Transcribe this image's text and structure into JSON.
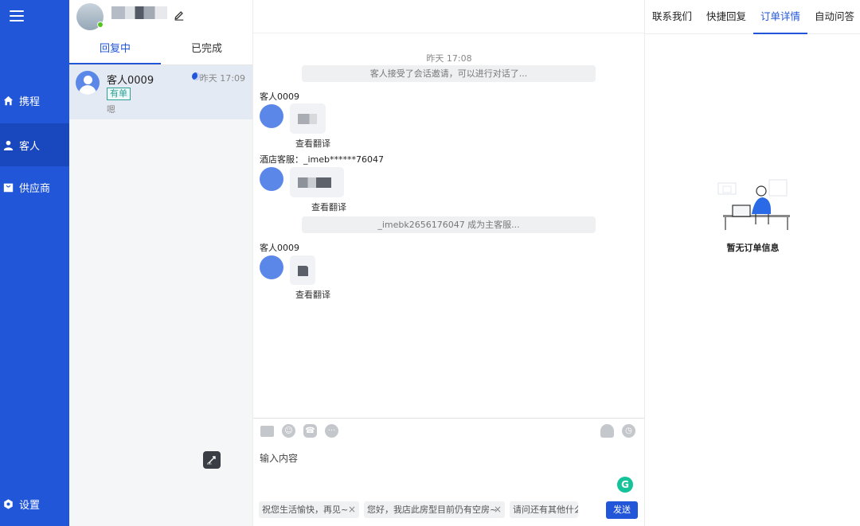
{
  "nav": {
    "items": [
      {
        "label": "携程",
        "icon": "home-icon"
      },
      {
        "label": "客人",
        "icon": "user-icon"
      },
      {
        "label": "供应商",
        "icon": "bag-icon"
      }
    ],
    "settings": "设置"
  },
  "list": {
    "tabs": [
      "回复中",
      "已完成"
    ],
    "conversation": {
      "name": "客人0009",
      "badge": "有单",
      "preview": "嗯",
      "time": "昨天 17:09"
    }
  },
  "chat": {
    "time": "昨天 17:08",
    "sys1": "客人接受了会话邀请，可以进行对话了...",
    "sender1": "客人0009",
    "translate": "查看翻译",
    "sender2": "酒店客服：_imeb******76047",
    "sys2": "_imebk2656176047 成为主客服...",
    "sender3": "客人0009",
    "input_placeholder": "输入内容",
    "chips": [
      "祝您生活愉快，再见~",
      "您好，我店此房型目前仍有空房~",
      "请问还有其他什么"
    ],
    "send": "发送"
  },
  "right": {
    "tabs": [
      "联系我们",
      "快捷回复",
      "订单详情",
      "自动问答"
    ],
    "empty": "暂无订单信息"
  },
  "colors": {
    "primary": "#2156d9",
    "nav_active": "#1947bd",
    "badge": "#2aa096"
  }
}
